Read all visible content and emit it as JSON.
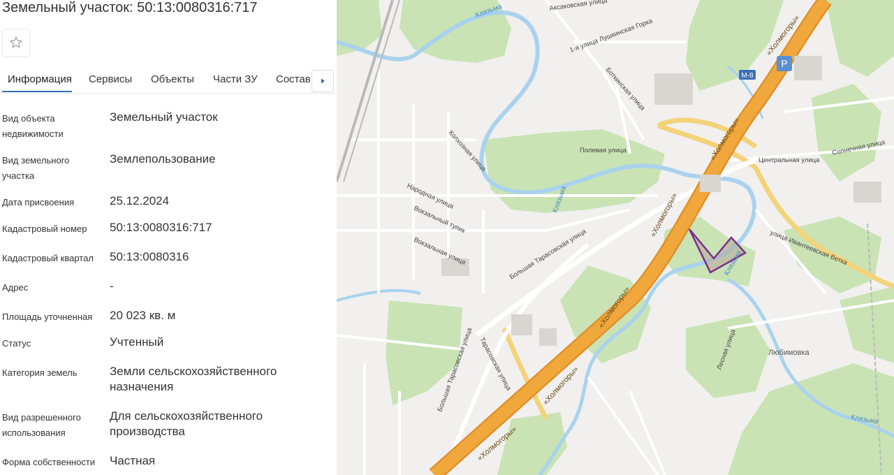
{
  "header": {
    "title": "Земельный участок: 50:13:0080316:717",
    "favorite_icon": "star-outline-icon"
  },
  "tabs": [
    {
      "label": "Информация",
      "active": true
    },
    {
      "label": "Сервисы",
      "active": false
    },
    {
      "label": "Объекты",
      "active": false
    },
    {
      "label": "Части ЗУ",
      "active": false
    },
    {
      "label": "Состав",
      "active": false
    }
  ],
  "tabs_next_icon": "triangle-right-icon",
  "info": [
    {
      "label": "Вид объекта недвижимости",
      "value": "Земельный участок"
    },
    {
      "label": "Вид земельного участка",
      "value": "Землепользование"
    },
    {
      "label": "Дата присвоения",
      "value": "25.12.2024"
    },
    {
      "label": "Кадастровый номер",
      "value": "50:13:0080316:717"
    },
    {
      "label": "Кадастровый квартал",
      "value": "50:13:0080316"
    },
    {
      "label": "Адрес",
      "value": "-"
    },
    {
      "label": "Площадь уточненная",
      "value": "20 023 кв. м"
    },
    {
      "label": "Статус",
      "value": "Учтенный"
    },
    {
      "label": "Категория земель",
      "value": "Земли сельскохозяйственного назначения"
    },
    {
      "label": "Вид разрешенного использования",
      "value": "Для сельскохозяйственного производства"
    },
    {
      "label": "Форма собственности",
      "value": "Частная"
    }
  ],
  "map": {
    "colors": {
      "highway": "#f0a83c",
      "road_yellow": "#f3d37a",
      "green": "#c9e3b4",
      "water": "#a9d2ee",
      "parcel": "#7b2d8e"
    },
    "labels": {
      "kholmogory_1": "«Холмогоры»",
      "kholmogory_2": "«Холмогоры»",
      "kholmogory_3": "«Холмогоры»",
      "kholmogory_4": "«Холмогоры»",
      "kholmogory_5": "«Холмогоры»",
      "kholmogory_6": "«Холмогоры»",
      "m8": "М-8",
      "lyubimovka": "Любимовка",
      "klyazma_1": "Клязьма",
      "klyazma_2": "Клязьма",
      "klyazma_3": "Клязьма",
      "klyazma_4": "Клязьма",
      "bolshaya_tarasovskaya_1": "Большая Тарасовская улица",
      "bolshaya_tarasovskaya_2": "Большая Тарасовская улица",
      "ivanteevskaya": "улица Ивантеевская Ветка",
      "vokzalny_tupik": "Вокзальный тупик",
      "vokzalnaya": "Вокзальная улица",
      "narodnaya": "Народная улица",
      "polevaya": "Полевая улица",
      "centralnaya": "Центральная улица",
      "solnechnaya": "Солнечная улица",
      "lesnaya": "Лесная улица",
      "botkinskaya": "Боткинская улица",
      "aksakovskaya": "Аксаковская улица",
      "lushkinskaya": "1-я улица Лушкинская Горка",
      "tarasovskaya": "Тарасовская улица",
      "kolhoznaya": "Колхозная улица",
      "parking": "P"
    }
  }
}
